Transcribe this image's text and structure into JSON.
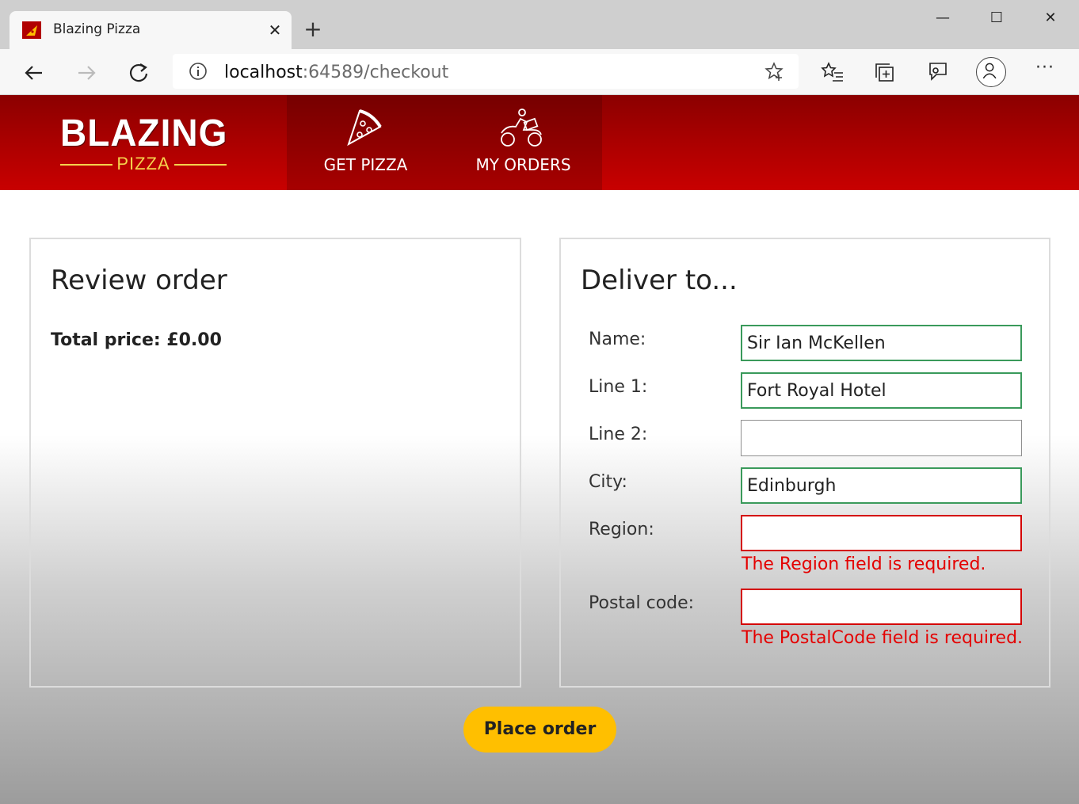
{
  "browser": {
    "tab_title": "Blazing Pizza",
    "url_host": "localhost",
    "url_path": ":64589/checkout",
    "window_controls": [
      "minimize",
      "maximize",
      "close"
    ]
  },
  "header": {
    "logo_main": "BLAZING",
    "logo_sub": "PIZZA",
    "nav": [
      {
        "label": "GET PIZZA",
        "icon": "pizza-slice-icon"
      },
      {
        "label": "MY ORDERS",
        "icon": "delivery-scooter-icon"
      }
    ]
  },
  "review": {
    "title": "Review order",
    "total_label": "Total price: £0.00"
  },
  "delivery": {
    "title": "Deliver to...",
    "fields": [
      {
        "label": "Name:",
        "value": "Sir Ian McKellen",
        "state": "valid",
        "error": ""
      },
      {
        "label": "Line 1:",
        "value": "Fort Royal Hotel",
        "state": "valid",
        "error": ""
      },
      {
        "label": "Line 2:",
        "value": "",
        "state": "neutral",
        "error": ""
      },
      {
        "label": "City:",
        "value": "Edinburgh",
        "state": "valid",
        "error": ""
      },
      {
        "label": "Region:",
        "value": "",
        "state": "invalid",
        "error": "The Region field is required."
      },
      {
        "label": "Postal code:",
        "value": "",
        "state": "invalid",
        "error": "The PostalCode field is required."
      }
    ]
  },
  "actions": {
    "place_order": "Place order"
  },
  "colors": {
    "brand_red": "#b10000",
    "accent_yellow": "#ffbf00",
    "valid_green": "#3a9a5b",
    "error_red": "#e40000"
  }
}
